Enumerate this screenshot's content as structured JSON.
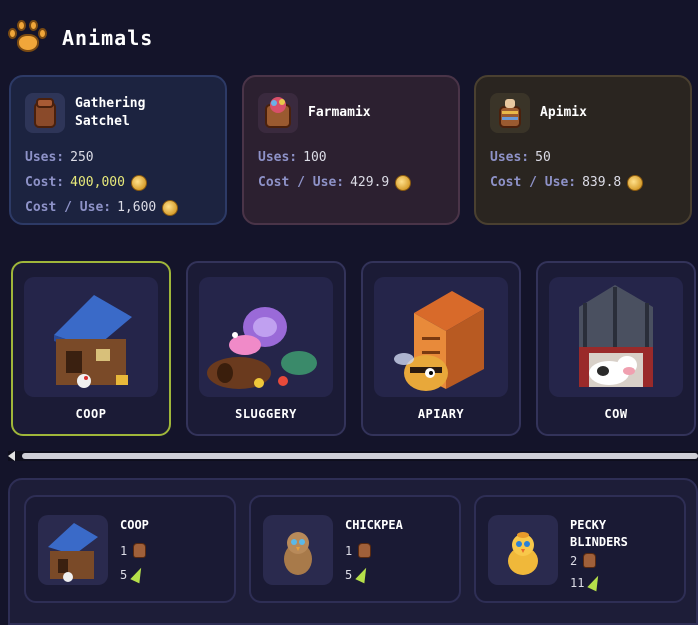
{
  "header": {
    "title": "Animals",
    "icon": "paw-icon"
  },
  "tools": [
    {
      "name": "Gathering Satchel",
      "uses_label": "Uses:",
      "uses": "250",
      "cost_label": "Cost:",
      "cost": "400,000",
      "cpu_label": "Cost / Use:",
      "cost_per_use": "1,600",
      "icon": "satchel-icon"
    },
    {
      "name": "Farmamix",
      "uses_label": "Uses:",
      "uses": "100",
      "cpu_label": "Cost / Use:",
      "cost_per_use": "429.9",
      "icon": "farmamix-icon"
    },
    {
      "name": "Apimix",
      "uses_label": "Uses:",
      "uses": "50",
      "cpu_label": "Cost / Use:",
      "cost_per_use": "839.8",
      "icon": "apimix-icon"
    }
  ],
  "buildings": [
    {
      "label": "COOP",
      "selected": true
    },
    {
      "label": "SLUGGERY",
      "selected": false
    },
    {
      "label": "APIARY",
      "selected": false
    },
    {
      "label": "COW",
      "selected": false
    }
  ],
  "requirements": [
    {
      "name": "COOP",
      "satchel": "1",
      "energy": "5"
    },
    {
      "name": "CHICKPEA",
      "satchel": "1",
      "energy": "5"
    },
    {
      "name": "PECKY BLINDERS",
      "satchel": "2",
      "energy": "11"
    }
  ],
  "colors": {
    "accent": "#9fb63a",
    "background": "#14142a",
    "highlight_value": "#e6e87a"
  }
}
